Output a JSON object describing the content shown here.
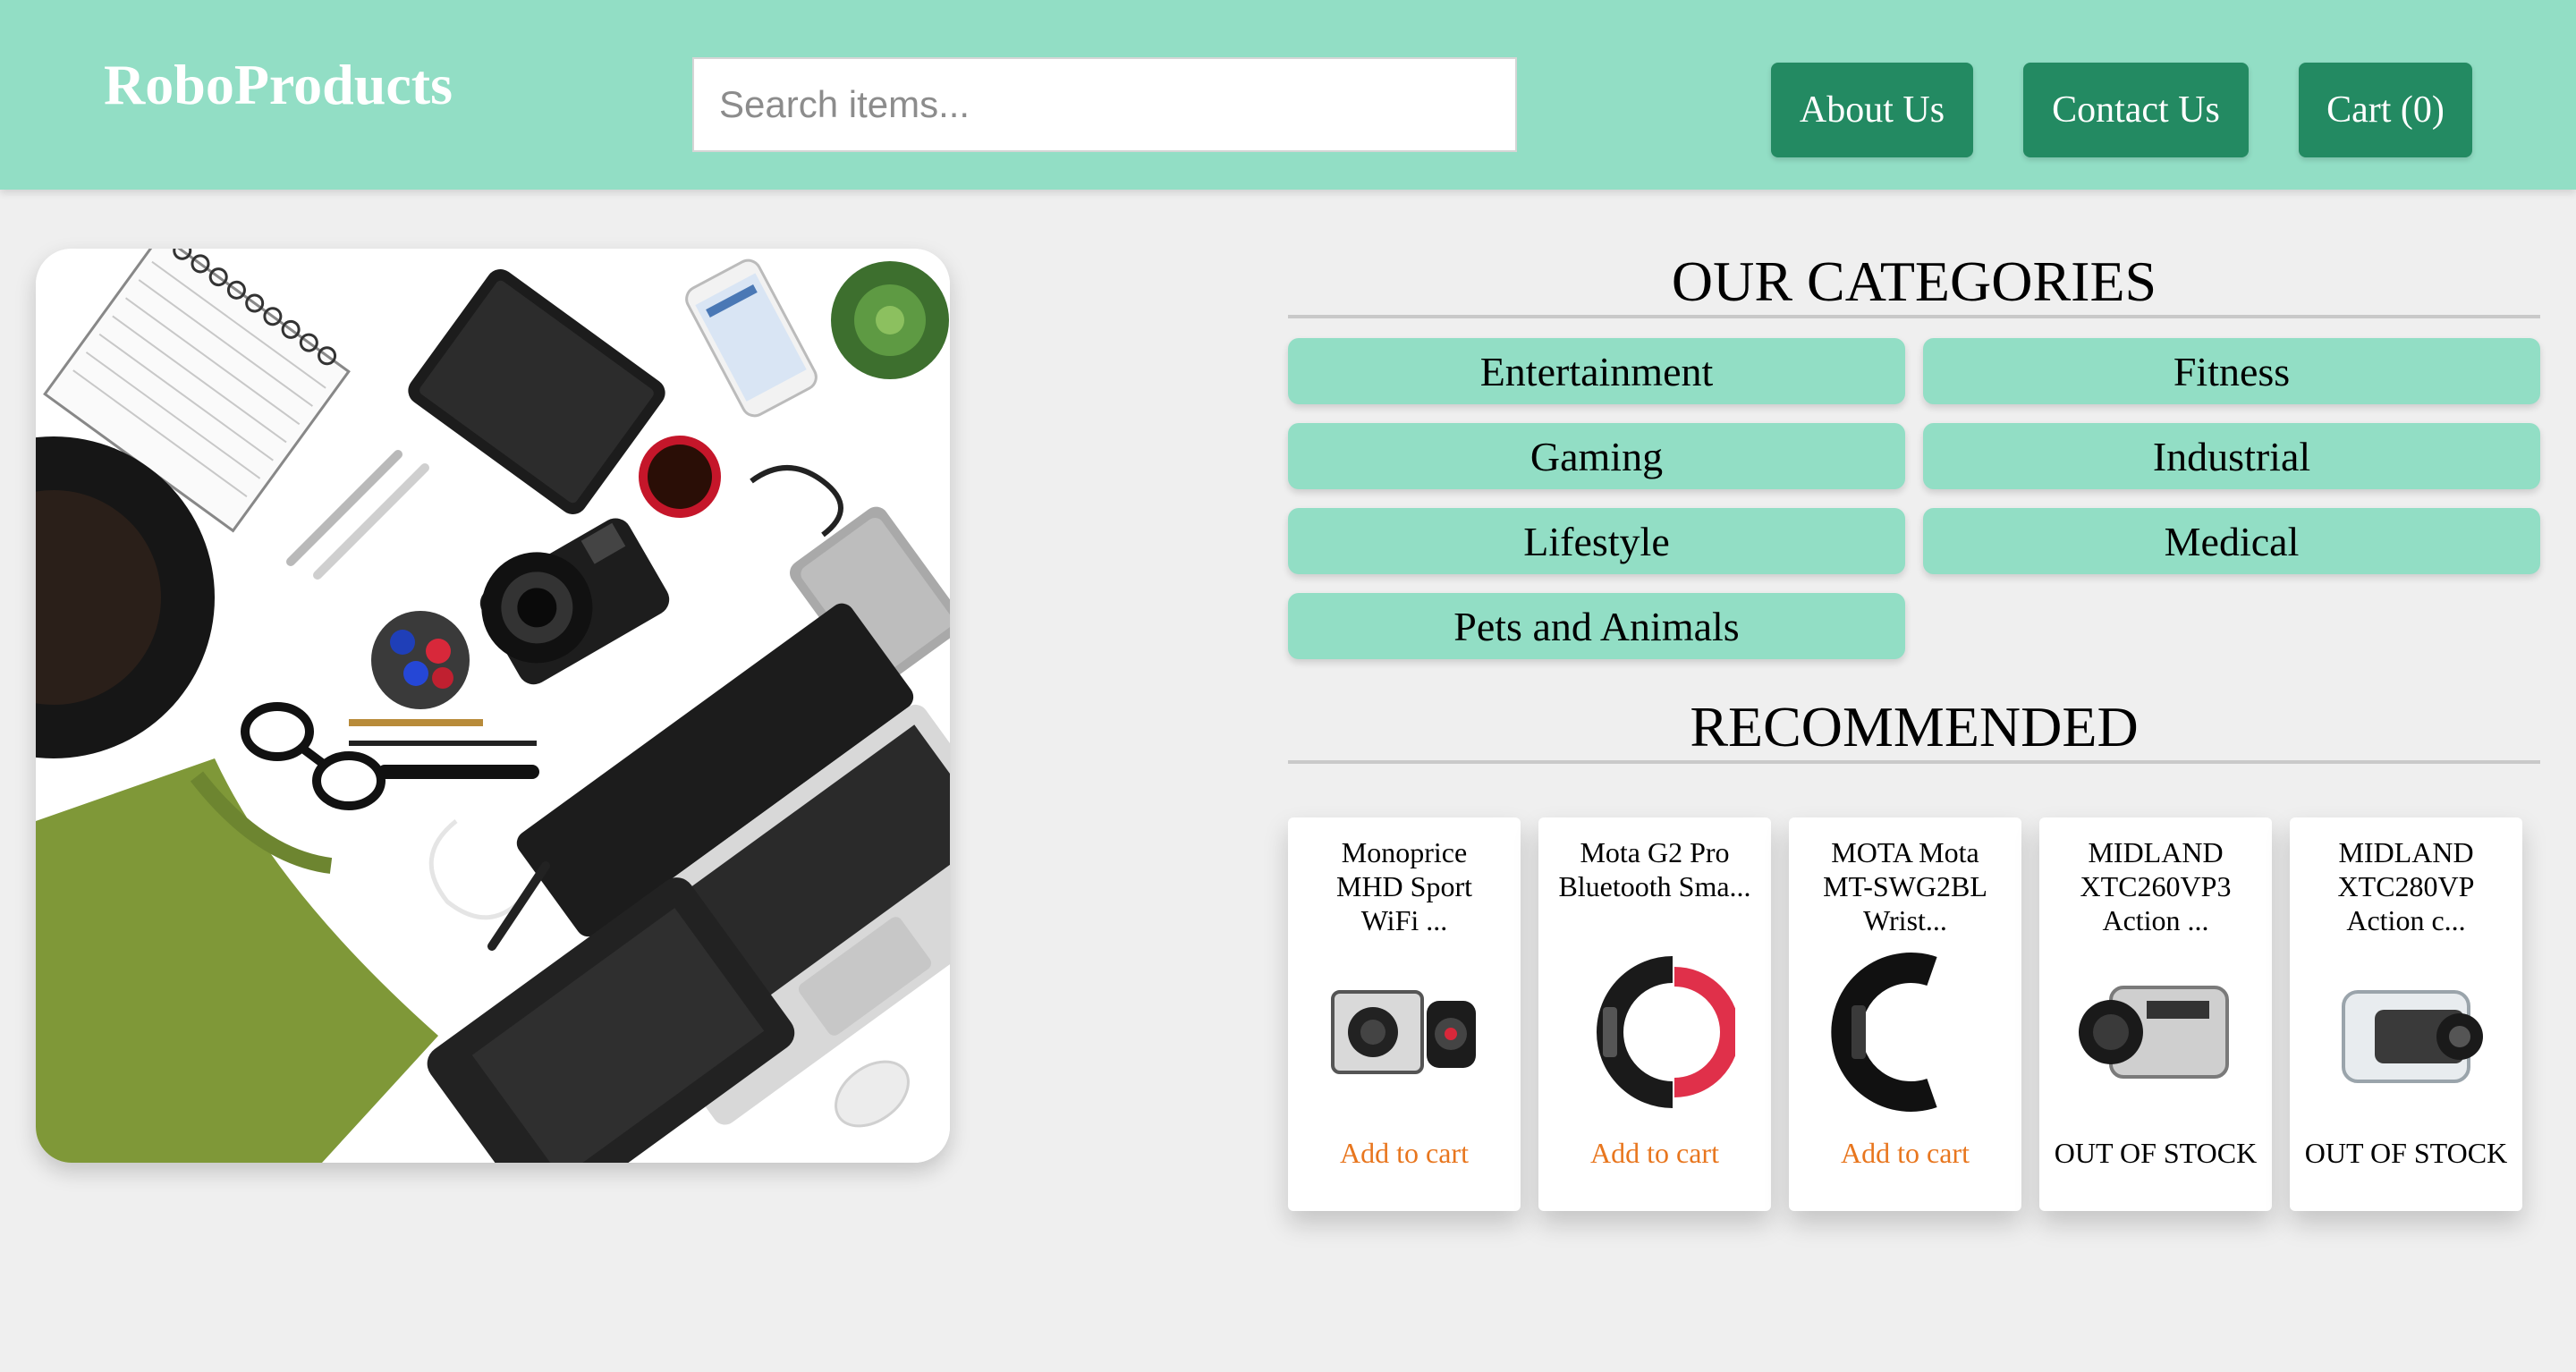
{
  "header": {
    "brand": "RoboProducts",
    "search_placeholder": "Search items...",
    "nav": {
      "about": "About Us",
      "contact": "Contact Us",
      "cart": "Cart (0)"
    }
  },
  "hero": {
    "image": "flat-lay-electronics-photo"
  },
  "categories": {
    "title": "OUR CATEGORIES",
    "items": [
      "Entertainment",
      "Fitness",
      "Gaming",
      "Industrial",
      "Lifestyle",
      "Medical",
      "Pets and Animals"
    ]
  },
  "recommended": {
    "title": "RECOMMENDED",
    "products": [
      {
        "name_lines": [
          "Monoprice",
          "MHD Sport",
          "WiFi ..."
        ],
        "action": "Add to cart",
        "image": "action-camera-with-remote-icon"
      },
      {
        "name_lines": [
          "Mota G2 Pro",
          "Bluetooth Sma..."
        ],
        "action": "Add to cart",
        "image": "red-smart-band-icon"
      },
      {
        "name_lines": [
          "MOTA Mota",
          "MT-SWG2BL",
          "Wrist..."
        ],
        "action": "Add to cart",
        "image": "black-smart-band-icon"
      },
      {
        "name_lines": [
          "MIDLAND",
          "XTC260VP3",
          "Action ..."
        ],
        "action": "OUT OF STOCK",
        "image": "silver-action-camera-icon"
      },
      {
        "name_lines": [
          "MIDLAND",
          "XTC280VP",
          "Action c..."
        ],
        "action": "OUT OF STOCK",
        "image": "waterproof-action-camera-icon"
      }
    ]
  },
  "colors": {
    "header_bg": "#92dec5",
    "nav_button": "#238a62",
    "category_bg": "#92dec5",
    "add_to_cart": "#e8761e"
  }
}
